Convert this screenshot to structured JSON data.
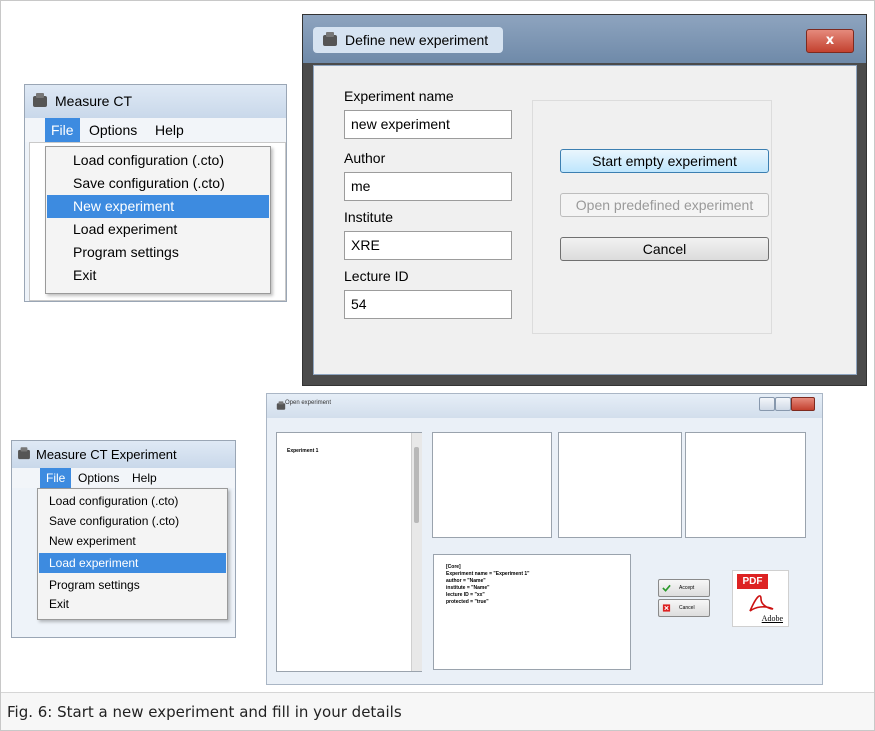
{
  "window_measure_ct": {
    "title": "Measure CT",
    "menu": [
      "File",
      "Options",
      "Help"
    ],
    "file_menu": [
      "Load configuration (.cto)",
      "Save configuration (.cto)",
      "New experiment",
      "Load experiment",
      "Program settings",
      "Exit"
    ],
    "selected_item": "New experiment"
  },
  "window_define_experiment": {
    "title": "Define new experiment",
    "close_glyph": "x",
    "fields": [
      {
        "label": "Experiment name",
        "value": "new experiment"
      },
      {
        "label": "Author",
        "value": "me"
      },
      {
        "label": "Institute",
        "value": "XRE"
      },
      {
        "label": "Lecture ID",
        "value": "54"
      }
    ],
    "buttons": {
      "start_empty": "Start empty experiment",
      "open_predefined": "Open predefined experiment",
      "cancel": "Cancel"
    }
  },
  "window_measure_ct_experiment": {
    "title": "Measure CT Experiment",
    "menu": [
      "File",
      "Options",
      "Help"
    ],
    "file_menu": [
      "Load configuration (.cto)",
      "Save configuration (.cto)",
      "New experiment",
      "Load experiment",
      "Program settings",
      "Exit"
    ],
    "selected_item": "Load experiment"
  },
  "window_open_experiment": {
    "title": "Open experiment",
    "list_items": [
      "Experiment 1"
    ],
    "details": [
      "[Core]",
      "Experiment name = \"Experiment 1\"",
      "author = \"Name\"",
      "institute = \"Name\"",
      "lecture ID = \"xx\"",
      "protected = \"true\""
    ],
    "accept_label": "Accept",
    "cancel_label": "Cancel",
    "pdf_label": "PDF",
    "adobe_label": "Adobe"
  },
  "caption": "Fig. 6: Start a new experiment and fill in your details",
  "colors": {
    "selection": "#3d8be0",
    "close_button": "#c3412f",
    "pdf_red": "#dd2222"
  }
}
